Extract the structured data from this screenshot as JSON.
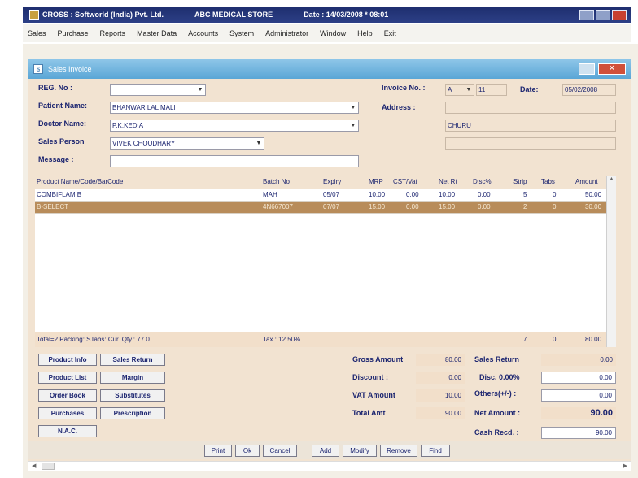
{
  "app": {
    "title_company": "CROSS : Softworld (India) Pvt. Ltd.",
    "title_store": "ABC MEDICAL STORE",
    "title_date": "Date : 14/03/2008 * 08:01"
  },
  "menu": [
    "Sales",
    "Purchase",
    "Reports",
    "Master Data",
    "Accounts",
    "System",
    "Administrator",
    "Window",
    "Help",
    "Exit"
  ],
  "window": {
    "title": "Sales Invoice"
  },
  "form": {
    "reg_no_label": "REG. No :",
    "reg_no_value": "",
    "patient_label": "Patient Name:",
    "patient_value": "BHANWAR LAL MALI",
    "doctor_label": "Doctor Name:",
    "doctor_value": "P.K.KEDIA",
    "sales_person_label": "Sales Person",
    "sales_person_value": "VIVEK CHOUDHARY",
    "message_label": "Message :",
    "message_value": "",
    "invoice_label": "Invoice No. :",
    "invoice_series": "A",
    "invoice_number": "11",
    "date_label": "Date:",
    "date_value": "05/02/2008",
    "address_label": "Address :",
    "address_line1": "",
    "address_line2": "CHURU",
    "address_line3": ""
  },
  "grid": {
    "headers": [
      "Product Name/Code/BarCode",
      "Batch No",
      "Expiry",
      "MRP",
      "CST/Vat",
      "Net Rt",
      "Disc%",
      "Strip",
      "Tabs",
      "Amount"
    ],
    "rows": [
      {
        "product": "COMBIFLAM B",
        "batch": "MAH",
        "expiry": "05/07",
        "mrp": "10.00",
        "cst": "0.00",
        "net": "10.00",
        "disc": "0.00",
        "strip": "5",
        "tabs": "0",
        "amount": "50.00"
      },
      {
        "product": "B-SELECT",
        "batch": "4N667007",
        "expiry": "07/07",
        "mrp": "15.00",
        "cst": "0.00",
        "net": "15.00",
        "disc": "0.00",
        "strip": "2",
        "tabs": "0",
        "amount": "30.00"
      }
    ],
    "footer_total": "Total=2 Packing: STabs: Cur. Qty.: 77.0",
    "footer_tax": "Tax : 12.50%",
    "footer_strip": "7",
    "footer_tabs": "0",
    "footer_amount": "80.00"
  },
  "action_buttons": [
    "Product Info",
    "Sales Return",
    "Product List",
    "Margin",
    "Order Book",
    "Substitutes",
    "Purchases",
    "Prescription",
    "N.A.C."
  ],
  "totals": {
    "gross_label": "Gross Amount",
    "gross_value": "80.00",
    "discount_label": "Discount :",
    "discount_value": "0.00",
    "vat_label": "VAT Amount",
    "vat_value": "10.00",
    "total_label": "Total Amt",
    "total_value": "90.00",
    "sales_return_label": "Sales Return",
    "sales_return_value": "0.00",
    "disc_pct_label": "Disc. 0.00%",
    "disc_pct_value": "0.00",
    "others_label": "Others(+/-) :",
    "others_value": "0.00",
    "net_label": "Net Amount :",
    "net_value": "90.00",
    "cash_label": "Cash Recd. :",
    "cash_value": "90.00"
  },
  "bottom_buttons": [
    "Print",
    "Ok",
    "Cancel",
    "Add",
    "Modify",
    "Remove",
    "Find"
  ]
}
